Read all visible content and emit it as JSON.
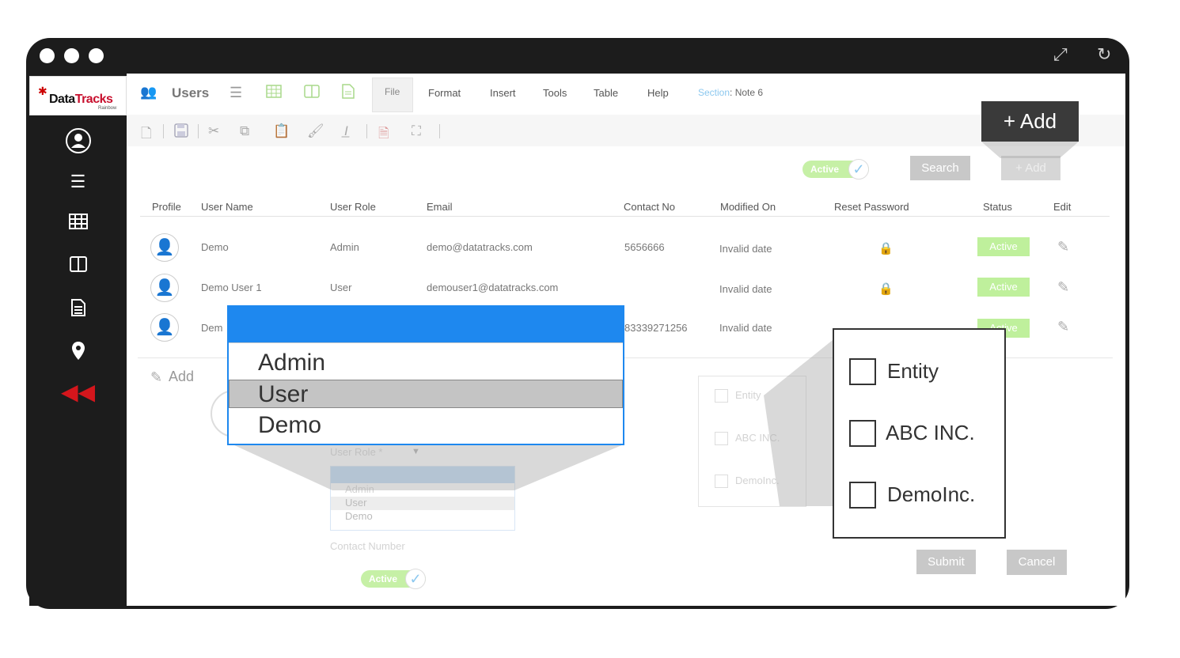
{
  "window": {
    "expand_icon": "expand-icon",
    "refresh_icon": "refresh-icon"
  },
  "logo": {
    "brand_prefix": "Data",
    "brand_suffix": "Tracks",
    "tagline": "Rainbow"
  },
  "sidebar": {
    "items": [
      "user-circle-icon",
      "list-icon",
      "table-icon",
      "columns-icon",
      "document-icon",
      "location-pin-icon",
      "collapse-double-arrow-icon"
    ]
  },
  "menubar": {
    "title": "Users",
    "items": [
      "File",
      "Format",
      "Insert",
      "Tools",
      "Table",
      "Help"
    ],
    "section_label": "Section",
    "section_value": ": Note 6"
  },
  "actions": {
    "active_toggle": "Active",
    "search_button": "Search",
    "add_button": "+ Add",
    "add_button_zoom": "+ Add"
  },
  "table": {
    "headers": [
      "Profile",
      "User Name",
      "User Role",
      "Email",
      "Contact No",
      "Modified On",
      "Reset Password",
      "Status",
      "Edit"
    ],
    "rows": [
      {
        "name": "Demo",
        "role": "Admin",
        "email": "demo@datatracks.com",
        "contact": "5656666",
        "modified": "Invalid date",
        "status": "Active"
      },
      {
        "name": "Demo User 1",
        "role": "User",
        "email": "demouser1@datatracks.com",
        "contact": "",
        "modified": "Invalid date",
        "status": "Active"
      },
      {
        "name": "Dem",
        "role": "",
        "email": "",
        "contact": "83339271256",
        "modified": "Invalid date",
        "status": "Active"
      }
    ]
  },
  "form": {
    "add_label": "Add",
    "user_role_label": "User Role",
    "required_mark": "*",
    "role_options": [
      "Admin",
      "User",
      "Demo"
    ],
    "contact_label": "Contact Number",
    "active_toggle": "Active",
    "submit": "Submit",
    "cancel": "Cancel",
    "entities": [
      "Entity",
      "ABC INC.",
      "DemoInc."
    ]
  },
  "zoom_dropdown": {
    "options": [
      "Admin",
      "User",
      "Demo"
    ],
    "selected": "User"
  },
  "zoom_checklist": {
    "items": [
      "Entity",
      "ABC INC.",
      "DemoInc."
    ]
  }
}
